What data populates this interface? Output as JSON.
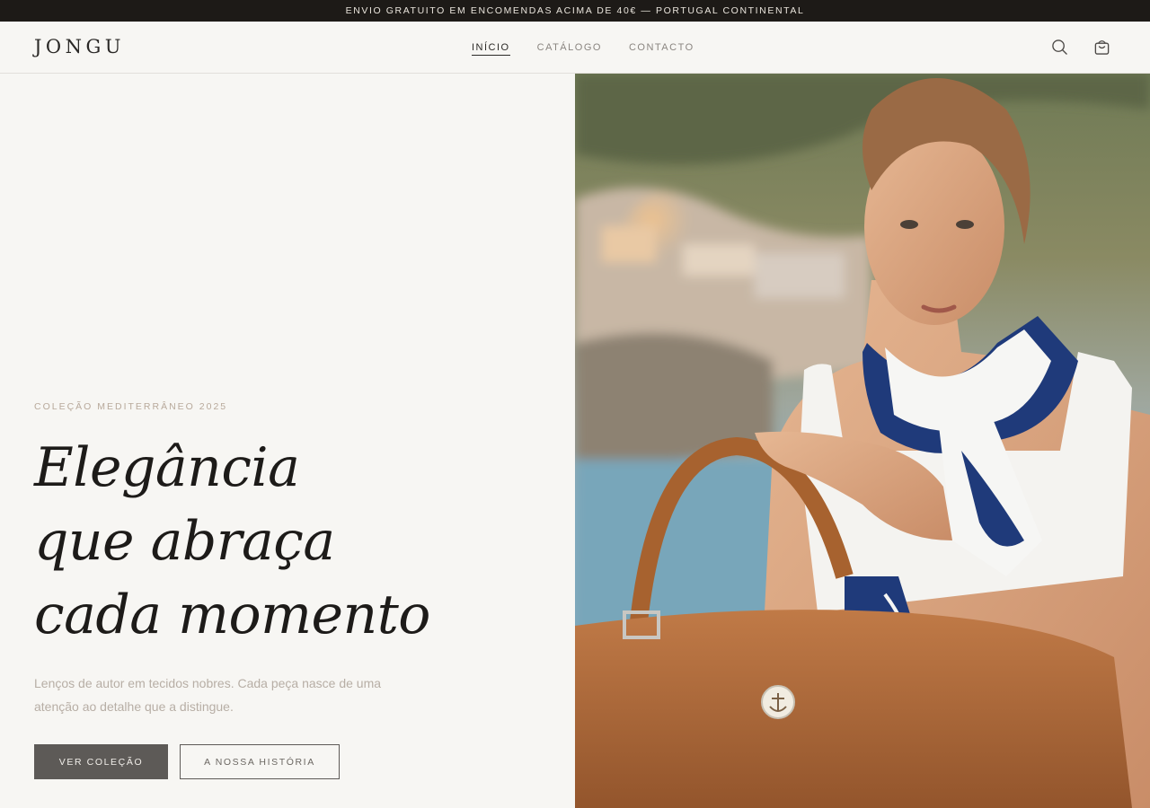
{
  "announcement": "ENVIO GRATUITO EM ENCOMENDAS ACIMA DE 40€ — PORTUGAL CONTINENTAL",
  "brand": "JONGU",
  "nav": {
    "items": [
      {
        "label": "INÍCIO",
        "active": true
      },
      {
        "label": "CATÁLOGO",
        "active": false
      },
      {
        "label": "CONTACTO",
        "active": false
      }
    ]
  },
  "header_icons": [
    "search-icon",
    "cart-icon"
  ],
  "hero": {
    "eyebrow": "COLEÇÃO MEDITERRÂNEO 2025",
    "headline": [
      "Elegância",
      "que abraça",
      "cada momento"
    ],
    "description": "Lenços de autor em tecidos nobres. Cada peça nasce de uma atenção ao detalhe que a distingue.",
    "primary_button": "VER COLEÇÃO",
    "secondary_button": "A NOSSA HISTÓRIA"
  },
  "colors": {
    "topbar": "#1d1a17",
    "background": "#f7f6f3",
    "primary_button": "#5d5a57",
    "scarf_navy": "#1f3a7a",
    "bag_tan": "#b06b3c"
  }
}
